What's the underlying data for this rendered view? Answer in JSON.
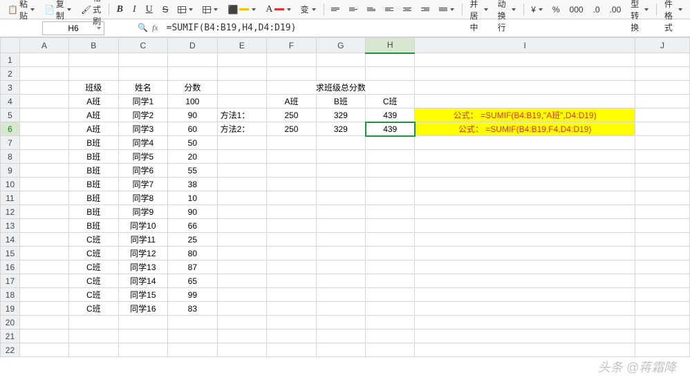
{
  "toolbar": {
    "paste": "粘贴",
    "copy": "复制",
    "format_paint": "格式刷",
    "merge_center": "合并居中",
    "auto_wrap": "自动换行",
    "currency": "¥",
    "percent": "%",
    "num_icon1": "000",
    "num_icon2": ".0",
    "num_icon3": ".00",
    "type_convert": "类型转换",
    "cond_format": "条件格式"
  },
  "namebox": "H6",
  "formula": "=SUMIF(B4:B19,H4,D4:D19)",
  "columns": [
    "A",
    "B",
    "C",
    "D",
    "E",
    "F",
    "G",
    "H",
    "I",
    "J"
  ],
  "rows": 22,
  "data": {
    "headers": {
      "b3": "班级",
      "c3": "姓名",
      "d3": "分数"
    },
    "sum_title": "求班级总分数",
    "classes_hdr": {
      "f4": "A班",
      "g4": "B班",
      "h4": "C班"
    },
    "method1_label": "方法1：",
    "method2_label": "方法2：",
    "results": {
      "f5": "250",
      "g5": "329",
      "h5": "439",
      "f6": "250",
      "g6": "329",
      "h6": "439"
    },
    "formulas": {
      "i5": "公式： =SUMIF(B4:B19,\"A班\",D4:D19)",
      "i6": "公式： =SUMIF(B4:B19,F4,D4:D19)"
    },
    "table": [
      {
        "b": "A班",
        "c": "同学1",
        "d": "100"
      },
      {
        "b": "A班",
        "c": "同学2",
        "d": "90"
      },
      {
        "b": "A班",
        "c": "同学3",
        "d": "60"
      },
      {
        "b": "B班",
        "c": "同学4",
        "d": "50"
      },
      {
        "b": "B班",
        "c": "同学5",
        "d": "20"
      },
      {
        "b": "B班",
        "c": "同学6",
        "d": "55"
      },
      {
        "b": "B班",
        "c": "同学7",
        "d": "38"
      },
      {
        "b": "B班",
        "c": "同学8",
        "d": "10"
      },
      {
        "b": "B班",
        "c": "同学9",
        "d": "90"
      },
      {
        "b": "B班",
        "c": "同学10",
        "d": "66"
      },
      {
        "b": "C班",
        "c": "同学11",
        "d": "25"
      },
      {
        "b": "C班",
        "c": "同学12",
        "d": "80"
      },
      {
        "b": "C班",
        "c": "同学13",
        "d": "87"
      },
      {
        "b": "C班",
        "c": "同学14",
        "d": "65"
      },
      {
        "b": "C班",
        "c": "同学15",
        "d": "99"
      },
      {
        "b": "C班",
        "c": "同学16",
        "d": "83"
      }
    ]
  },
  "watermark": "头条 @蒋霜降"
}
